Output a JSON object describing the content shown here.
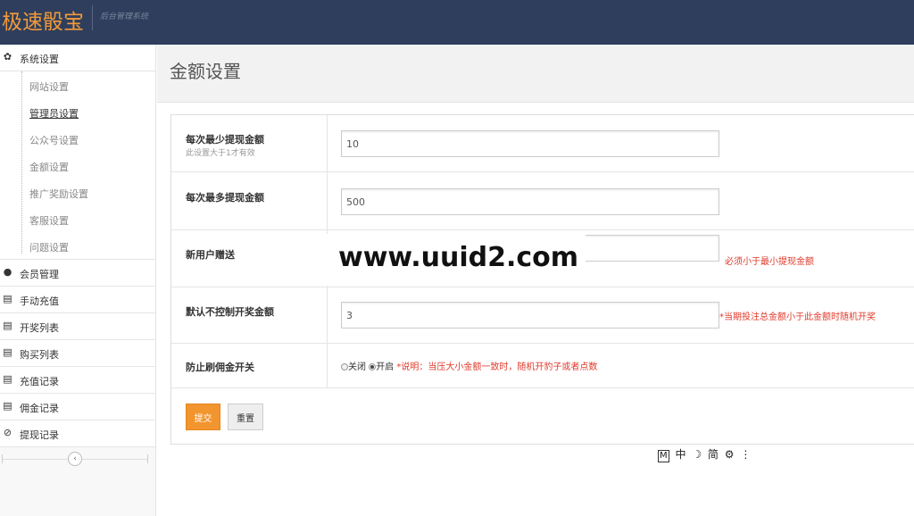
{
  "header": {
    "brand": "极速骰宝",
    "subtitle": "后台管理系统"
  },
  "sidebar": {
    "settings_group": {
      "label": "系统设置",
      "icon": "gear-icon"
    },
    "settings_items": [
      {
        "label": "网站设置"
      },
      {
        "label": "管理员设置",
        "active": true
      },
      {
        "label": "公众号设置"
      },
      {
        "label": "金额设置"
      },
      {
        "label": "推广奖励设置"
      },
      {
        "label": "客服设置"
      },
      {
        "label": "问题设置"
      }
    ],
    "groups": [
      {
        "label": "会员管理",
        "icon": "user-icon"
      },
      {
        "label": "手动充值",
        "icon": "list-icon"
      },
      {
        "label": "开奖列表",
        "icon": "list-icon"
      },
      {
        "label": "购买列表",
        "icon": "list-icon"
      },
      {
        "label": "充值记录",
        "icon": "list-icon"
      },
      {
        "label": "佣金记录",
        "icon": "list-icon"
      },
      {
        "label": "提现记录",
        "icon": "ban-icon"
      }
    ],
    "collapse_icon": "chevron-left-icon"
  },
  "page": {
    "title": "金额设置"
  },
  "form": {
    "min_withdraw": {
      "label": "每次最少提现金额",
      "hint": "此设置大于1才有效",
      "value": "10"
    },
    "max_withdraw": {
      "label": "每次最多提现金额",
      "value": "500"
    },
    "new_user_gift": {
      "label": "新用户赠送",
      "value": "",
      "note": "必须小于最小提现金额"
    },
    "default_uncontrolled": {
      "label": "默认不控制开奖金额",
      "value": "3",
      "note": "*当期投注总金额小于此金额时随机开奖"
    },
    "anti_commission": {
      "label": "防止刷佣金开关",
      "off_label": "关闭",
      "on_label": "开启",
      "selected": "开启",
      "note": "*说明：当压大小金额一致时，随机开豹子或者点数"
    },
    "submit_label": "提交",
    "reset_label": "重置"
  },
  "watermark": "www.uuid2.com",
  "ime_bar": {
    "mode": "M",
    "lang": "中",
    "moon": "☽",
    "simplified": "简",
    "gear": "⚙",
    "more": "⋮"
  },
  "colors": {
    "topbar": "#2f3e5c",
    "brand": "#f19a3a",
    "accent_button": "#f2952f",
    "note_red": "#e03a2b"
  }
}
